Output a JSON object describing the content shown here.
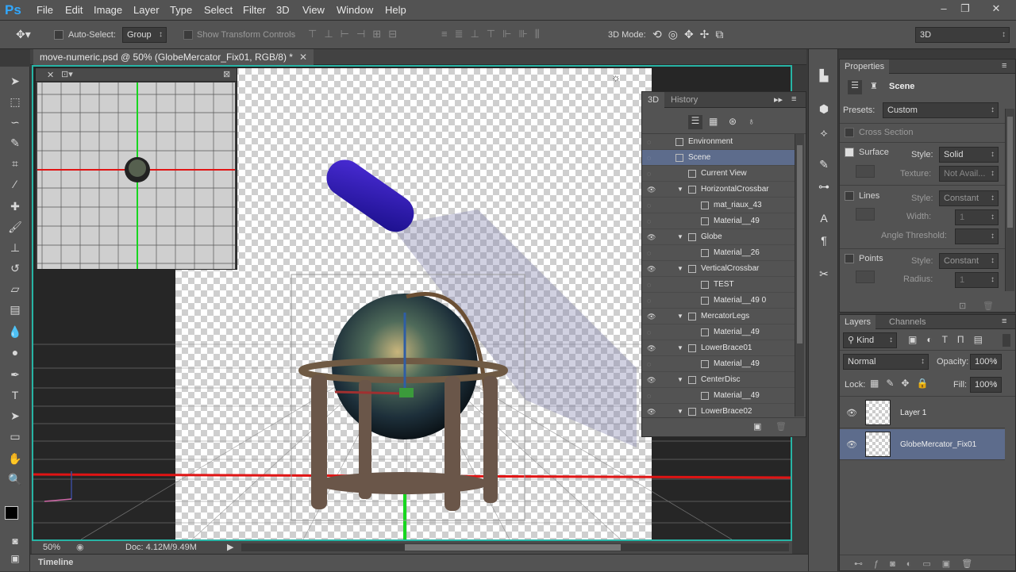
{
  "app": {
    "logo": "Ps"
  },
  "menu": [
    "File",
    "Edit",
    "Image",
    "Layer",
    "Type",
    "Select",
    "Filter",
    "3D",
    "View",
    "Window",
    "Help"
  ],
  "window_controls": {
    "minimize": "–",
    "restore": "❐",
    "close": "✕"
  },
  "options": {
    "auto_select_label": "Auto-Select:",
    "auto_select_value": "Group",
    "show_transform_label": "Show Transform Controls",
    "mode_label": "3D Mode:",
    "workspace": "3D"
  },
  "document": {
    "tab_title": "move-numeric.psd @ 50% (GlobeMercator_Fix01, RGB/8) *",
    "zoom": "50%",
    "doc_info": "Doc: 4.12M/9.49M",
    "timeline_label": "Timeline"
  },
  "panel3d": {
    "tabs": [
      "3D",
      "History"
    ],
    "rows": [
      {
        "name": "Environment",
        "indent": 0,
        "eye": false,
        "tri": false,
        "icon": "env-icon"
      },
      {
        "name": "Scene",
        "indent": 0,
        "eye": false,
        "tri": false,
        "icon": "scene-icon",
        "selected": true
      },
      {
        "name": "Current View",
        "indent": 1,
        "eye": false,
        "tri": false,
        "icon": "camera-icon"
      },
      {
        "name": "HorizontalCrossbar",
        "indent": 1,
        "eye": true,
        "tri": true,
        "icon": "mesh-icon"
      },
      {
        "name": "mat_riaux_43",
        "indent": 2,
        "eye": false,
        "tri": false,
        "icon": "material-icon"
      },
      {
        "name": "Material__49",
        "indent": 2,
        "eye": false,
        "tri": false,
        "icon": "material-icon"
      },
      {
        "name": "Globe",
        "indent": 1,
        "eye": true,
        "tri": true,
        "icon": "mesh-icon"
      },
      {
        "name": "Material__26",
        "indent": 2,
        "eye": false,
        "tri": false,
        "icon": "material-icon"
      },
      {
        "name": "VerticalCrossbar",
        "indent": 1,
        "eye": true,
        "tri": true,
        "icon": "mesh-icon"
      },
      {
        "name": "TEST",
        "indent": 2,
        "eye": false,
        "tri": false,
        "icon": "material-icon"
      },
      {
        "name": "Material__49 0",
        "indent": 2,
        "eye": false,
        "tri": false,
        "icon": "material-icon"
      },
      {
        "name": "MercatorLegs",
        "indent": 1,
        "eye": true,
        "tri": true,
        "icon": "mesh-icon"
      },
      {
        "name": "Material__49",
        "indent": 2,
        "eye": false,
        "tri": false,
        "icon": "material-icon"
      },
      {
        "name": "LowerBrace01",
        "indent": 1,
        "eye": true,
        "tri": true,
        "icon": "mesh-icon"
      },
      {
        "name": "Material__49",
        "indent": 2,
        "eye": false,
        "tri": false,
        "icon": "material-icon"
      },
      {
        "name": "CenterDisc",
        "indent": 1,
        "eye": true,
        "tri": true,
        "icon": "mesh-icon"
      },
      {
        "name": "Material__49",
        "indent": 2,
        "eye": false,
        "tri": false,
        "icon": "material-icon"
      },
      {
        "name": "LowerBrace02",
        "indent": 1,
        "eye": true,
        "tri": true,
        "icon": "mesh-icon"
      }
    ]
  },
  "properties": {
    "tab": "Properties",
    "mode": "Scene",
    "presets_label": "Presets:",
    "presets_value": "Custom",
    "cross_section": "Cross Section",
    "surface_label": "Surface",
    "surface_style_label": "Style:",
    "surface_style": "Solid",
    "texture_label": "Texture:",
    "texture_value": "Not Avail...",
    "lines_label": "Lines",
    "lines_style_label": "Style:",
    "lines_style": "Constant",
    "width_label": "Width:",
    "width_value": "1",
    "angle_label": "Angle Threshold:",
    "points_label": "Points",
    "points_style_label": "Style:",
    "points_style": "Constant",
    "radius_label": "Radius:",
    "radius_value": "1"
  },
  "layers": {
    "tabs": [
      "Layers",
      "Channels"
    ],
    "kind": "Kind",
    "blend": "Normal",
    "opacity_label": "Opacity:",
    "opacity": "100%",
    "lock_label": "Lock:",
    "fill_label": "Fill:",
    "fill": "100%",
    "items": [
      {
        "name": "Layer 1",
        "selected": false
      },
      {
        "name": "GlobeMercator_Fix01",
        "selected": true
      }
    ]
  },
  "colors": {
    "accent": "#27b4a5",
    "selection": "#5d6c8c",
    "panel": "#535353"
  }
}
